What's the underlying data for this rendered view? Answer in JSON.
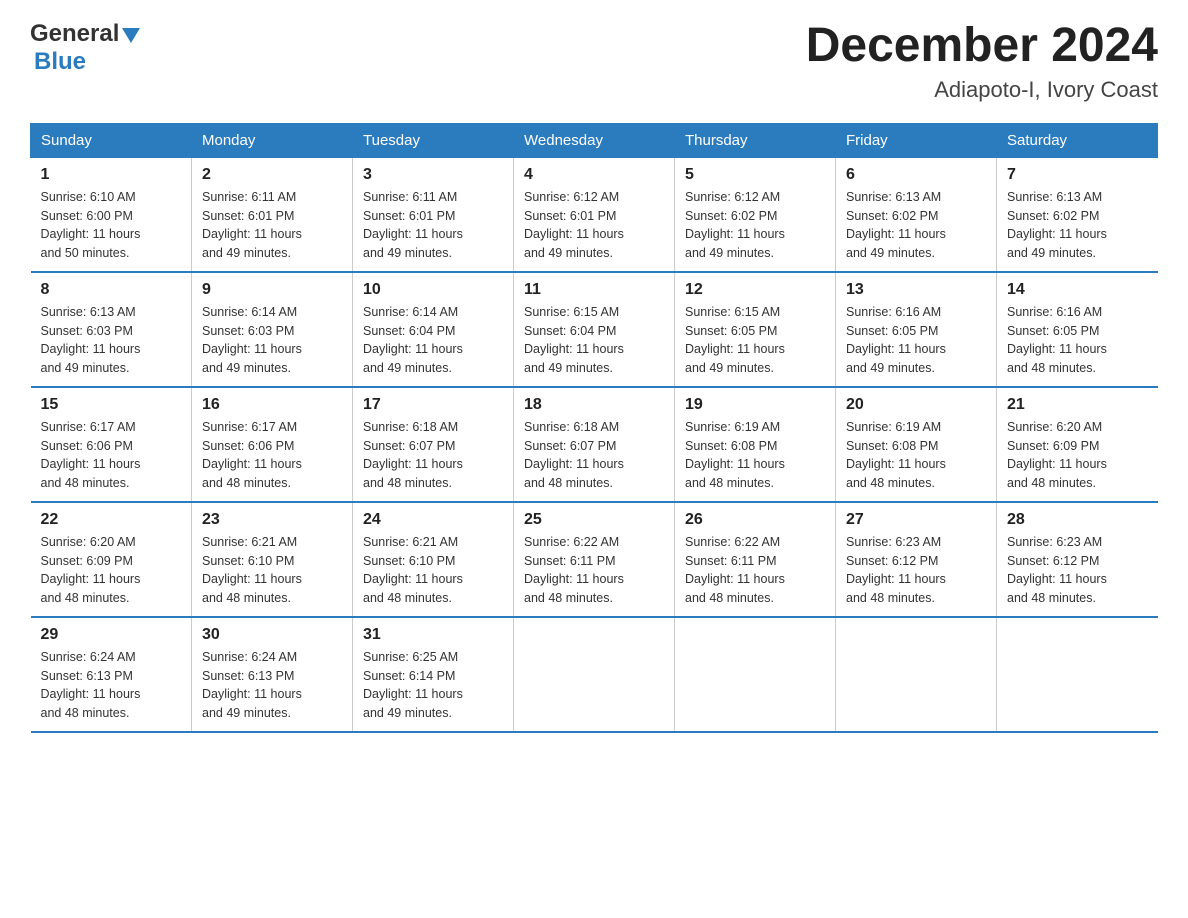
{
  "logo": {
    "general": "General",
    "blue": "Blue"
  },
  "title": "December 2024",
  "location": "Adiapoto-I, Ivory Coast",
  "days_of_week": [
    "Sunday",
    "Monday",
    "Tuesday",
    "Wednesday",
    "Thursday",
    "Friday",
    "Saturday"
  ],
  "weeks": [
    [
      {
        "day": "1",
        "sunrise": "6:10 AM",
        "sunset": "6:00 PM",
        "daylight": "11 hours and 50 minutes."
      },
      {
        "day": "2",
        "sunrise": "6:11 AM",
        "sunset": "6:01 PM",
        "daylight": "11 hours and 49 minutes."
      },
      {
        "day": "3",
        "sunrise": "6:11 AM",
        "sunset": "6:01 PM",
        "daylight": "11 hours and 49 minutes."
      },
      {
        "day": "4",
        "sunrise": "6:12 AM",
        "sunset": "6:01 PM",
        "daylight": "11 hours and 49 minutes."
      },
      {
        "day": "5",
        "sunrise": "6:12 AM",
        "sunset": "6:02 PM",
        "daylight": "11 hours and 49 minutes."
      },
      {
        "day": "6",
        "sunrise": "6:13 AM",
        "sunset": "6:02 PM",
        "daylight": "11 hours and 49 minutes."
      },
      {
        "day": "7",
        "sunrise": "6:13 AM",
        "sunset": "6:02 PM",
        "daylight": "11 hours and 49 minutes."
      }
    ],
    [
      {
        "day": "8",
        "sunrise": "6:13 AM",
        "sunset": "6:03 PM",
        "daylight": "11 hours and 49 minutes."
      },
      {
        "day": "9",
        "sunrise": "6:14 AM",
        "sunset": "6:03 PM",
        "daylight": "11 hours and 49 minutes."
      },
      {
        "day": "10",
        "sunrise": "6:14 AM",
        "sunset": "6:04 PM",
        "daylight": "11 hours and 49 minutes."
      },
      {
        "day": "11",
        "sunrise": "6:15 AM",
        "sunset": "6:04 PM",
        "daylight": "11 hours and 49 minutes."
      },
      {
        "day": "12",
        "sunrise": "6:15 AM",
        "sunset": "6:05 PM",
        "daylight": "11 hours and 49 minutes."
      },
      {
        "day": "13",
        "sunrise": "6:16 AM",
        "sunset": "6:05 PM",
        "daylight": "11 hours and 49 minutes."
      },
      {
        "day": "14",
        "sunrise": "6:16 AM",
        "sunset": "6:05 PM",
        "daylight": "11 hours and 48 minutes."
      }
    ],
    [
      {
        "day": "15",
        "sunrise": "6:17 AM",
        "sunset": "6:06 PM",
        "daylight": "11 hours and 48 minutes."
      },
      {
        "day": "16",
        "sunrise": "6:17 AM",
        "sunset": "6:06 PM",
        "daylight": "11 hours and 48 minutes."
      },
      {
        "day": "17",
        "sunrise": "6:18 AM",
        "sunset": "6:07 PM",
        "daylight": "11 hours and 48 minutes."
      },
      {
        "day": "18",
        "sunrise": "6:18 AM",
        "sunset": "6:07 PM",
        "daylight": "11 hours and 48 minutes."
      },
      {
        "day": "19",
        "sunrise": "6:19 AM",
        "sunset": "6:08 PM",
        "daylight": "11 hours and 48 minutes."
      },
      {
        "day": "20",
        "sunrise": "6:19 AM",
        "sunset": "6:08 PM",
        "daylight": "11 hours and 48 minutes."
      },
      {
        "day": "21",
        "sunrise": "6:20 AM",
        "sunset": "6:09 PM",
        "daylight": "11 hours and 48 minutes."
      }
    ],
    [
      {
        "day": "22",
        "sunrise": "6:20 AM",
        "sunset": "6:09 PM",
        "daylight": "11 hours and 48 minutes."
      },
      {
        "day": "23",
        "sunrise": "6:21 AM",
        "sunset": "6:10 PM",
        "daylight": "11 hours and 48 minutes."
      },
      {
        "day": "24",
        "sunrise": "6:21 AM",
        "sunset": "6:10 PM",
        "daylight": "11 hours and 48 minutes."
      },
      {
        "day": "25",
        "sunrise": "6:22 AM",
        "sunset": "6:11 PM",
        "daylight": "11 hours and 48 minutes."
      },
      {
        "day": "26",
        "sunrise": "6:22 AM",
        "sunset": "6:11 PM",
        "daylight": "11 hours and 48 minutes."
      },
      {
        "day": "27",
        "sunrise": "6:23 AM",
        "sunset": "6:12 PM",
        "daylight": "11 hours and 48 minutes."
      },
      {
        "day": "28",
        "sunrise": "6:23 AM",
        "sunset": "6:12 PM",
        "daylight": "11 hours and 48 minutes."
      }
    ],
    [
      {
        "day": "29",
        "sunrise": "6:24 AM",
        "sunset": "6:13 PM",
        "daylight": "11 hours and 48 minutes."
      },
      {
        "day": "30",
        "sunrise": "6:24 AM",
        "sunset": "6:13 PM",
        "daylight": "11 hours and 49 minutes."
      },
      {
        "day": "31",
        "sunrise": "6:25 AM",
        "sunset": "6:14 PM",
        "daylight": "11 hours and 49 minutes."
      },
      null,
      null,
      null,
      null
    ]
  ],
  "labels": {
    "sunrise": "Sunrise:",
    "sunset": "Sunset:",
    "daylight": "Daylight:"
  }
}
